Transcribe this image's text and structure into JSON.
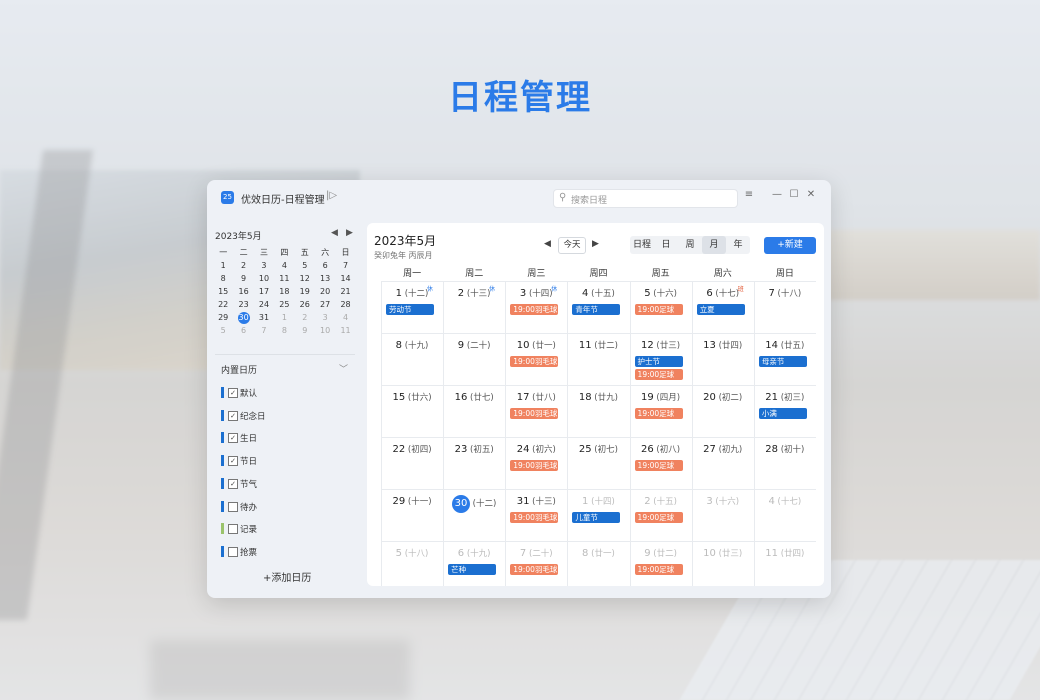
{
  "headline": "日程管理",
  "window": {
    "logo": "25",
    "title": "优效日历-日程管理",
    "search_placeholder": "搜索日程",
    "menu_icon": "≡",
    "minimize_icon": "—",
    "maximize_icon": "☐",
    "close_icon": "✕"
  },
  "sidebar": {
    "mini_month": "2023年5月",
    "weekdays": [
      "一",
      "二",
      "三",
      "四",
      "五",
      "六",
      "日"
    ],
    "mini_weeks": [
      [
        "1",
        "2",
        "3",
        "4",
        "5",
        "6",
        "7"
      ],
      [
        "8",
        "9",
        "10",
        "11",
        "12",
        "13",
        "14"
      ],
      [
        "15",
        "16",
        "17",
        "18",
        "19",
        "20",
        "21"
      ],
      [
        "22",
        "23",
        "24",
        "25",
        "26",
        "27",
        "28"
      ],
      [
        "29",
        "30",
        "31",
        "1",
        "2",
        "3",
        "4"
      ],
      [
        "5",
        "6",
        "7",
        "8",
        "9",
        "10",
        "11"
      ]
    ],
    "selected_day": "30",
    "group_label": "内置日历",
    "calendars": [
      {
        "label": "默认",
        "checked": true,
        "color": "#1b6fd0"
      },
      {
        "label": "纪念日",
        "checked": true,
        "color": "#1b6fd0"
      },
      {
        "label": "生日",
        "checked": true,
        "color": "#1b6fd0"
      },
      {
        "label": "节日",
        "checked": true,
        "color": "#1b6fd0"
      },
      {
        "label": "节气",
        "checked": true,
        "color": "#1b6fd0"
      },
      {
        "label": "待办",
        "checked": false,
        "color": "#1b6fd0"
      },
      {
        "label": "记录",
        "checked": false,
        "color": "#9bc36b"
      },
      {
        "label": "抢票",
        "checked": false,
        "color": "#1b6fd0"
      }
    ],
    "add_calendar": "+添加日历"
  },
  "main": {
    "month_title": "2023年5月",
    "lunar_sub": "癸卯兔年 丙辰月",
    "today_label": "今天",
    "views": [
      "日程",
      "日",
      "周",
      "月",
      "年"
    ],
    "active_view": "月",
    "new_button": "+新建",
    "weekdays": [
      "周一",
      "周二",
      "周三",
      "周四",
      "周五",
      "周六",
      "周日"
    ],
    "weeks": [
      [
        {
          "d": "1",
          "l": "(十二)",
          "badge": "休",
          "events": [
            {
              "t": "劳动节",
              "c": "blue"
            }
          ]
        },
        {
          "d": "2",
          "l": "(十三)",
          "badge": "休",
          "events": []
        },
        {
          "d": "3",
          "l": "(十四)",
          "badge": "休",
          "events": [
            {
              "t": "19:00羽毛球",
              "c": "orange"
            }
          ]
        },
        {
          "d": "4",
          "l": "(十五)",
          "events": [
            {
              "t": "青年节",
              "c": "blue"
            }
          ]
        },
        {
          "d": "5",
          "l": "(十六)",
          "events": [
            {
              "t": "19:00足球",
              "c": "orange"
            }
          ]
        },
        {
          "d": "6",
          "l": "(十七)",
          "badge": "班",
          "events": [
            {
              "t": "立夏",
              "c": "blue"
            }
          ]
        },
        {
          "d": "7",
          "l": "(十八)",
          "events": []
        }
      ],
      [
        {
          "d": "8",
          "l": "(十九)",
          "events": []
        },
        {
          "d": "9",
          "l": "(二十)",
          "events": []
        },
        {
          "d": "10",
          "l": "(廿一)",
          "events": [
            {
              "t": "19:00羽毛球",
              "c": "orange"
            }
          ]
        },
        {
          "d": "11",
          "l": "(廿二)",
          "events": []
        },
        {
          "d": "12",
          "l": "(廿三)",
          "events": [
            {
              "t": "护士节",
              "c": "blue"
            },
            {
              "t": "19:00足球",
              "c": "orange"
            }
          ]
        },
        {
          "d": "13",
          "l": "(廿四)",
          "events": []
        },
        {
          "d": "14",
          "l": "(廿五)",
          "events": [
            {
              "t": "母亲节",
              "c": "blue"
            }
          ]
        }
      ],
      [
        {
          "d": "15",
          "l": "(廿六)",
          "events": []
        },
        {
          "d": "16",
          "l": "(廿七)",
          "events": []
        },
        {
          "d": "17",
          "l": "(廿八)",
          "events": [
            {
              "t": "19:00羽毛球",
              "c": "orange"
            }
          ]
        },
        {
          "d": "18",
          "l": "(廿九)",
          "events": []
        },
        {
          "d": "19",
          "l": "(四月)",
          "events": [
            {
              "t": "19:00足球",
              "c": "orange"
            }
          ]
        },
        {
          "d": "20",
          "l": "(初二)",
          "events": []
        },
        {
          "d": "21",
          "l": "(初三)",
          "events": [
            {
              "t": "小满",
              "c": "blue"
            }
          ]
        }
      ],
      [
        {
          "d": "22",
          "l": "(初四)",
          "events": []
        },
        {
          "d": "23",
          "l": "(初五)",
          "events": []
        },
        {
          "d": "24",
          "l": "(初六)",
          "events": [
            {
              "t": "19:00羽毛球",
              "c": "orange"
            }
          ]
        },
        {
          "d": "25",
          "l": "(初七)",
          "events": []
        },
        {
          "d": "26",
          "l": "(初八)",
          "events": [
            {
              "t": "19:00足球",
              "c": "orange"
            }
          ]
        },
        {
          "d": "27",
          "l": "(初九)",
          "events": []
        },
        {
          "d": "28",
          "l": "(初十)",
          "events": []
        }
      ],
      [
        {
          "d": "29",
          "l": "(十一)",
          "events": []
        },
        {
          "d": "30",
          "l": "(十二)",
          "today": true,
          "events": []
        },
        {
          "d": "31",
          "l": "(十三)",
          "events": [
            {
              "t": "19:00羽毛球",
              "c": "orange"
            }
          ]
        },
        {
          "d": "1",
          "l": "(十四)",
          "dim": true,
          "events": [
            {
              "t": "儿童节",
              "c": "blue"
            }
          ]
        },
        {
          "d": "2",
          "l": "(十五)",
          "dim": true,
          "events": [
            {
              "t": "19:00足球",
              "c": "orange"
            }
          ]
        },
        {
          "d": "3",
          "l": "(十六)",
          "dim": true,
          "events": []
        },
        {
          "d": "4",
          "l": "(十七)",
          "dim": true,
          "events": []
        }
      ],
      [
        {
          "d": "5",
          "l": "(十八)",
          "dim": true,
          "events": []
        },
        {
          "d": "6",
          "l": "(十九)",
          "dim": true,
          "events": [
            {
              "t": "芒种",
              "c": "blue"
            }
          ]
        },
        {
          "d": "7",
          "l": "(二十)",
          "dim": true,
          "events": [
            {
              "t": "19:00羽毛球",
              "c": "orange"
            }
          ]
        },
        {
          "d": "8",
          "l": "(廿一)",
          "dim": true,
          "events": []
        },
        {
          "d": "9",
          "l": "(廿二)",
          "dim": true,
          "events": [
            {
              "t": "19:00足球",
              "c": "orange"
            }
          ]
        },
        {
          "d": "10",
          "l": "(廿三)",
          "dim": true,
          "events": []
        },
        {
          "d": "11",
          "l": "(廿四)",
          "dim": true,
          "events": []
        }
      ]
    ]
  }
}
